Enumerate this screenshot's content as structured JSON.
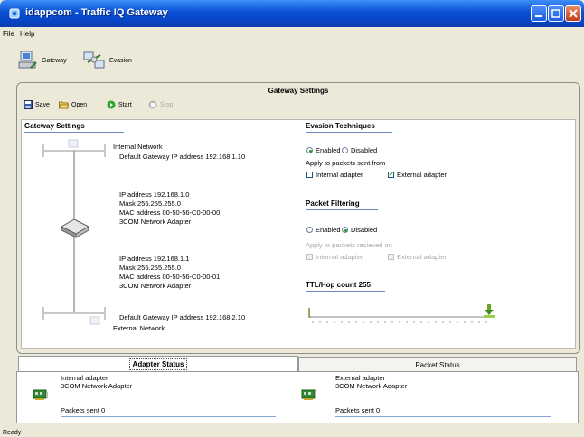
{
  "window": {
    "title": "idappcom - Traffic IQ Gateway"
  },
  "menu": {
    "items": [
      "File",
      "Help"
    ]
  },
  "toolbar": {
    "gateway": "Gateway",
    "evasion": "Evasion"
  },
  "panel": {
    "title": "Gateway Settings",
    "buttons": {
      "save": "Save",
      "open": "Open",
      "start": "Start",
      "stop": "Stop"
    }
  },
  "gateway_settings": {
    "title": "Gateway Settings",
    "internal_network": "Internal Network",
    "default_gw_1": "Default Gateway IP address 192.168.1.10",
    "adapter0": {
      "ip": "IP address 192.168.1.0",
      "mask": "Mask 255.255.255.0",
      "mac": "MAC address 00-50-56-C0-00-00",
      "name": "3COM Network Adapter"
    },
    "adapter1": {
      "ip": "IP address 192.168.1.1",
      "mask": "Mask 255.255.255.0",
      "mac": "MAC address 00-50-56-C0-00-01",
      "name": "3COM Network Adapter"
    },
    "default_gw_2": "Default Gateway IP address 192.168.2.10",
    "external_network": "External Network"
  },
  "evasion": {
    "title": "Evasion Techniques",
    "enabled": "Enabled",
    "disabled": "Disabled",
    "apply_label": "Apply to packets sent from",
    "internal_adapter": "Internal adapter",
    "external_adapter": "External adapter",
    "selected": "Enabled",
    "internal_checked": false,
    "external_checked": true
  },
  "filtering": {
    "title": "Packet Filtering",
    "enabled": "Enabled",
    "disabled": "Disabled",
    "apply_label": "Apply to packets recieved on",
    "internal_adapter": "Internal adapter",
    "external_adapter": "External adapter",
    "selected": "Disabled"
  },
  "ttl": {
    "title": "TTL/Hop count 255",
    "value": 255
  },
  "status": {
    "tabs": [
      "Adapter Status",
      "Packet Status"
    ],
    "internal": {
      "line1": "Internal adapter",
      "line2": "3COM Network Adapter",
      "packets": "Packets sent 0"
    },
    "external": {
      "line1": "External adapter",
      "line2": "3COM Network Adapter",
      "packets": "Packets sent 0"
    }
  },
  "statusbar": {
    "text": "Ready"
  },
  "colors": {
    "titlebar": "#0a4fd6",
    "accent_green": "#21a121",
    "section_line": "#6b87c4"
  }
}
